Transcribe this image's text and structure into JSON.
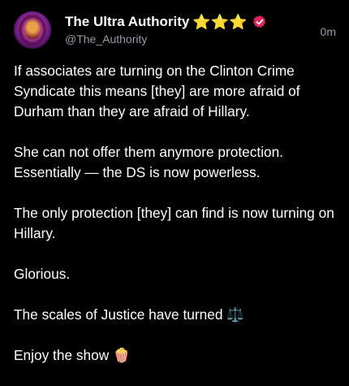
{
  "post": {
    "author_name": "The Ultra Authority",
    "stars": "⭐⭐⭐",
    "handle": "@The_Authority",
    "time": "0m",
    "paragraphs": [
      "If associates are turning on the Clinton Crime Syndicate this means [they] are more afraid of Durham than they are afraid of Hillary.",
      "She can not offer them anymore protection. Essentially — the DS is now powerless.",
      "The only protection [they] can find is now turning on Hillary.",
      "Glorious.",
      "The scales of Justice have turned ⚖️",
      "Enjoy the show 🍿"
    ]
  },
  "colors": {
    "background": "#000000",
    "text": "#ffffff",
    "muted": "#9a9aa3",
    "star": "#f5c518",
    "verified_badge": "#e0245e"
  },
  "icons": {
    "avatar": "profile-avatar",
    "verified": "verified-badge-icon"
  }
}
